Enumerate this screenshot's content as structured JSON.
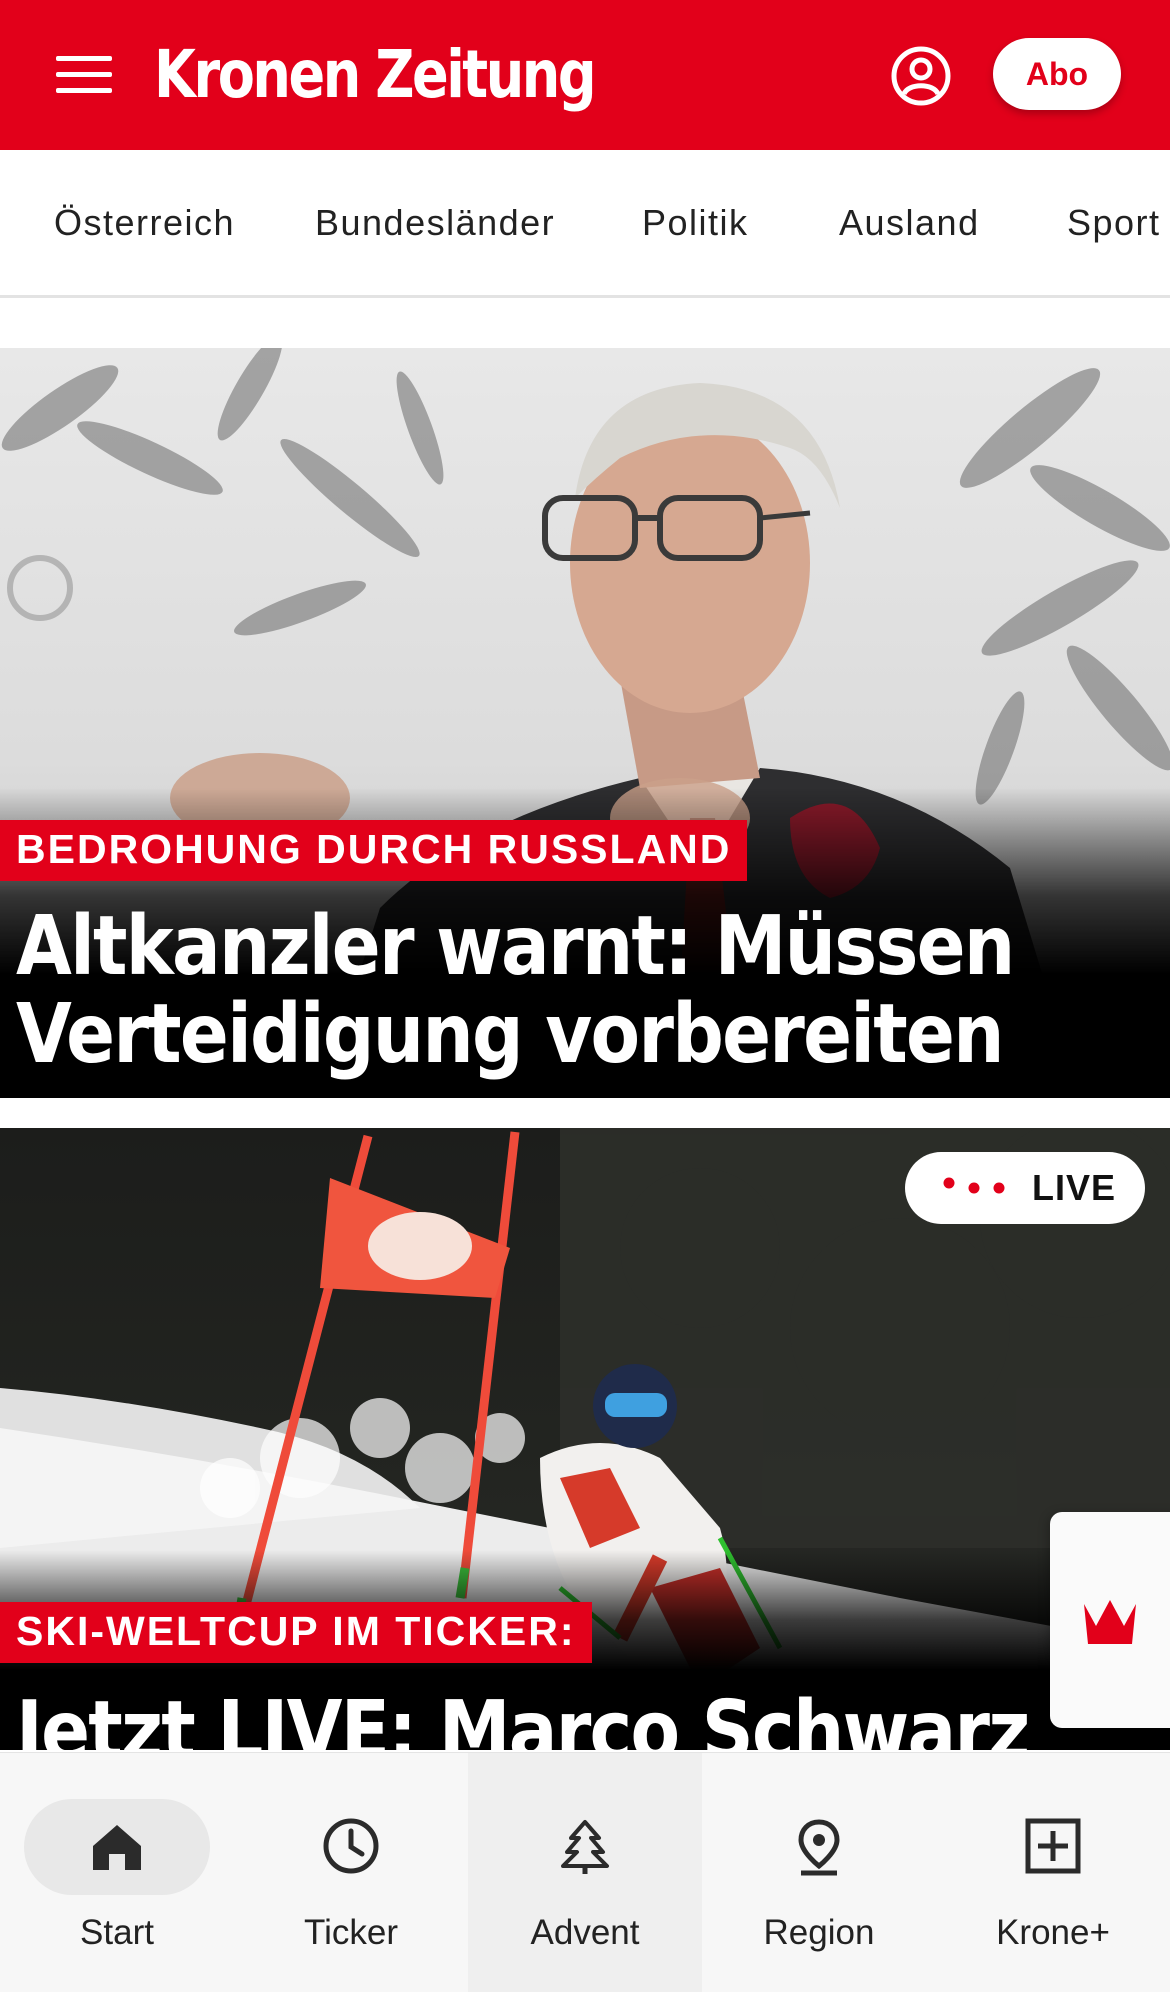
{
  "header": {
    "logo": "Kronen Zeitung",
    "abo_label": "Abo",
    "brand_color": "#e2001a"
  },
  "categories": [
    "Österreich",
    "Bundesländer",
    "Politik",
    "Ausland",
    "Sport"
  ],
  "articles": [
    {
      "kicker": "BEDROHUNG DURCH RUSSLAND",
      "headline_line1": "Altkanzler warnt: Müssen",
      "headline_line2": "Verteidigung vorbereiten"
    },
    {
      "kicker": "SKI-WELTCUP IM TICKER:",
      "headline_line1": "Jetzt LIVE: Marco Schwarz",
      "live_label": "LIVE"
    }
  ],
  "bottom_nav": {
    "items": [
      {
        "label": "Start",
        "icon": "home-icon"
      },
      {
        "label": "Ticker",
        "icon": "clock-icon"
      },
      {
        "label": "Advent",
        "icon": "tree-icon"
      },
      {
        "label": "Region",
        "icon": "location-pin-icon"
      },
      {
        "label": "Krone+",
        "icon": "plus-box-icon"
      }
    ],
    "active": "Start"
  }
}
